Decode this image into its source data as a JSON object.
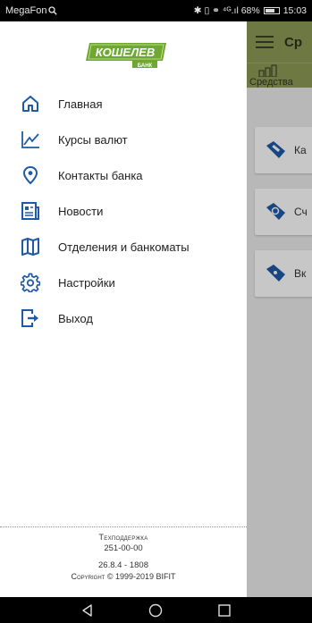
{
  "statusbar": {
    "carrier": "MegaFon",
    "indicators": "✱ ▯ ⚭ ⁴ᴳ.ıl 68%",
    "time": "15:03"
  },
  "drawer": {
    "logo_text": "КОШЕЛЕВ",
    "logo_sub": "БАНК",
    "items": [
      {
        "label": "Главная",
        "icon": "home-icon"
      },
      {
        "label": "Курсы валют",
        "icon": "chart-line-icon"
      },
      {
        "label": "Контакты банка",
        "icon": "location-pin-icon"
      },
      {
        "label": "Новости",
        "icon": "newspaper-icon"
      },
      {
        "label": "Отделения и банкоматы",
        "icon": "map-icon"
      },
      {
        "label": "Настройки",
        "icon": "gear-icon"
      },
      {
        "label": "Выход",
        "icon": "logout-icon"
      }
    ],
    "footer": {
      "support_label": "Техподдержка",
      "support_phone": "251-00-00",
      "version": "26.8.4 - 1808",
      "copyright": "Copyright © 1999-2019 BIFIT"
    }
  },
  "app": {
    "title": "Ср",
    "tab_label": "Средства",
    "cards": [
      {
        "label": "Ка"
      },
      {
        "label": "Сч"
      },
      {
        "label": "Вк"
      }
    ]
  },
  "colors": {
    "accent_blue": "#1e5aa8",
    "olive": "#8c9a55",
    "logo_green": "#6ea830"
  }
}
